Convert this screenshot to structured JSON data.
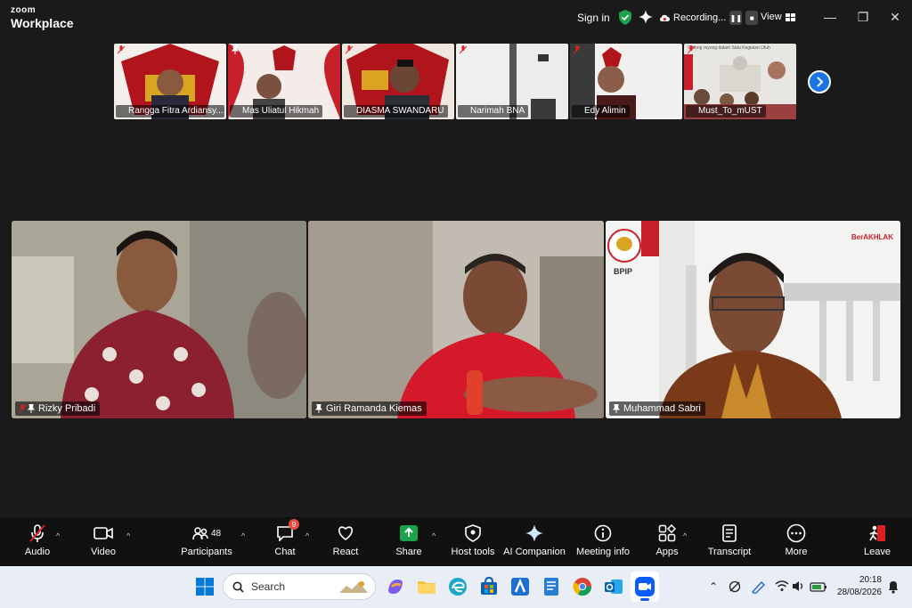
{
  "window": {
    "brand_top": "zoom",
    "brand_bottom": "Workplace",
    "sign_in": "Sign in",
    "recording": "Recording...",
    "view": "View",
    "minimize": "—",
    "maximize": "❐",
    "close": "✕"
  },
  "thumbnails": [
    {
      "name": "Rangga Fitra Ardiansy..."
    },
    {
      "name": "Mas Uliatul Hikmah"
    },
    {
      "name": "DIASMA SWANDARU"
    },
    {
      "name": "Narimah BNA"
    },
    {
      "name": "Edy Alimin"
    },
    {
      "name": "Must_To_mUST"
    }
  ],
  "thumb_banner_text": "Gotong royong dalam Satu Kegiatan Utuh",
  "tiles": [
    {
      "name": "Rizky Pribadi"
    },
    {
      "name": "Giri Ramanda Kiemas"
    },
    {
      "name": "Muhammad Sabri"
    }
  ],
  "tile3_logo_text": "BPIP",
  "tile3_brand": "BerAKHLAK",
  "toolbar": {
    "audio": "Audio",
    "video": "Video",
    "participants": "Participants",
    "participants_count": "48",
    "chat": "Chat",
    "chat_badge": "9",
    "react": "React",
    "share": "Share",
    "host_tools": "Host tools",
    "ai_companion": "AI Companion",
    "meeting_info": "Meeting info",
    "apps": "Apps",
    "transcript": "Transcript",
    "more": "More",
    "leave": "Leave",
    "caret": "^"
  },
  "taskbar": {
    "search_placeholder": "Search",
    "time": "20:18",
    "date": "28/08/2026"
  },
  "colors": {
    "active_speaker": "#2ecc40",
    "share_green": "#1aa34a",
    "next_blue": "#1a73e8",
    "badge_red": "#e74c3c",
    "leave_red": "#e02020"
  }
}
